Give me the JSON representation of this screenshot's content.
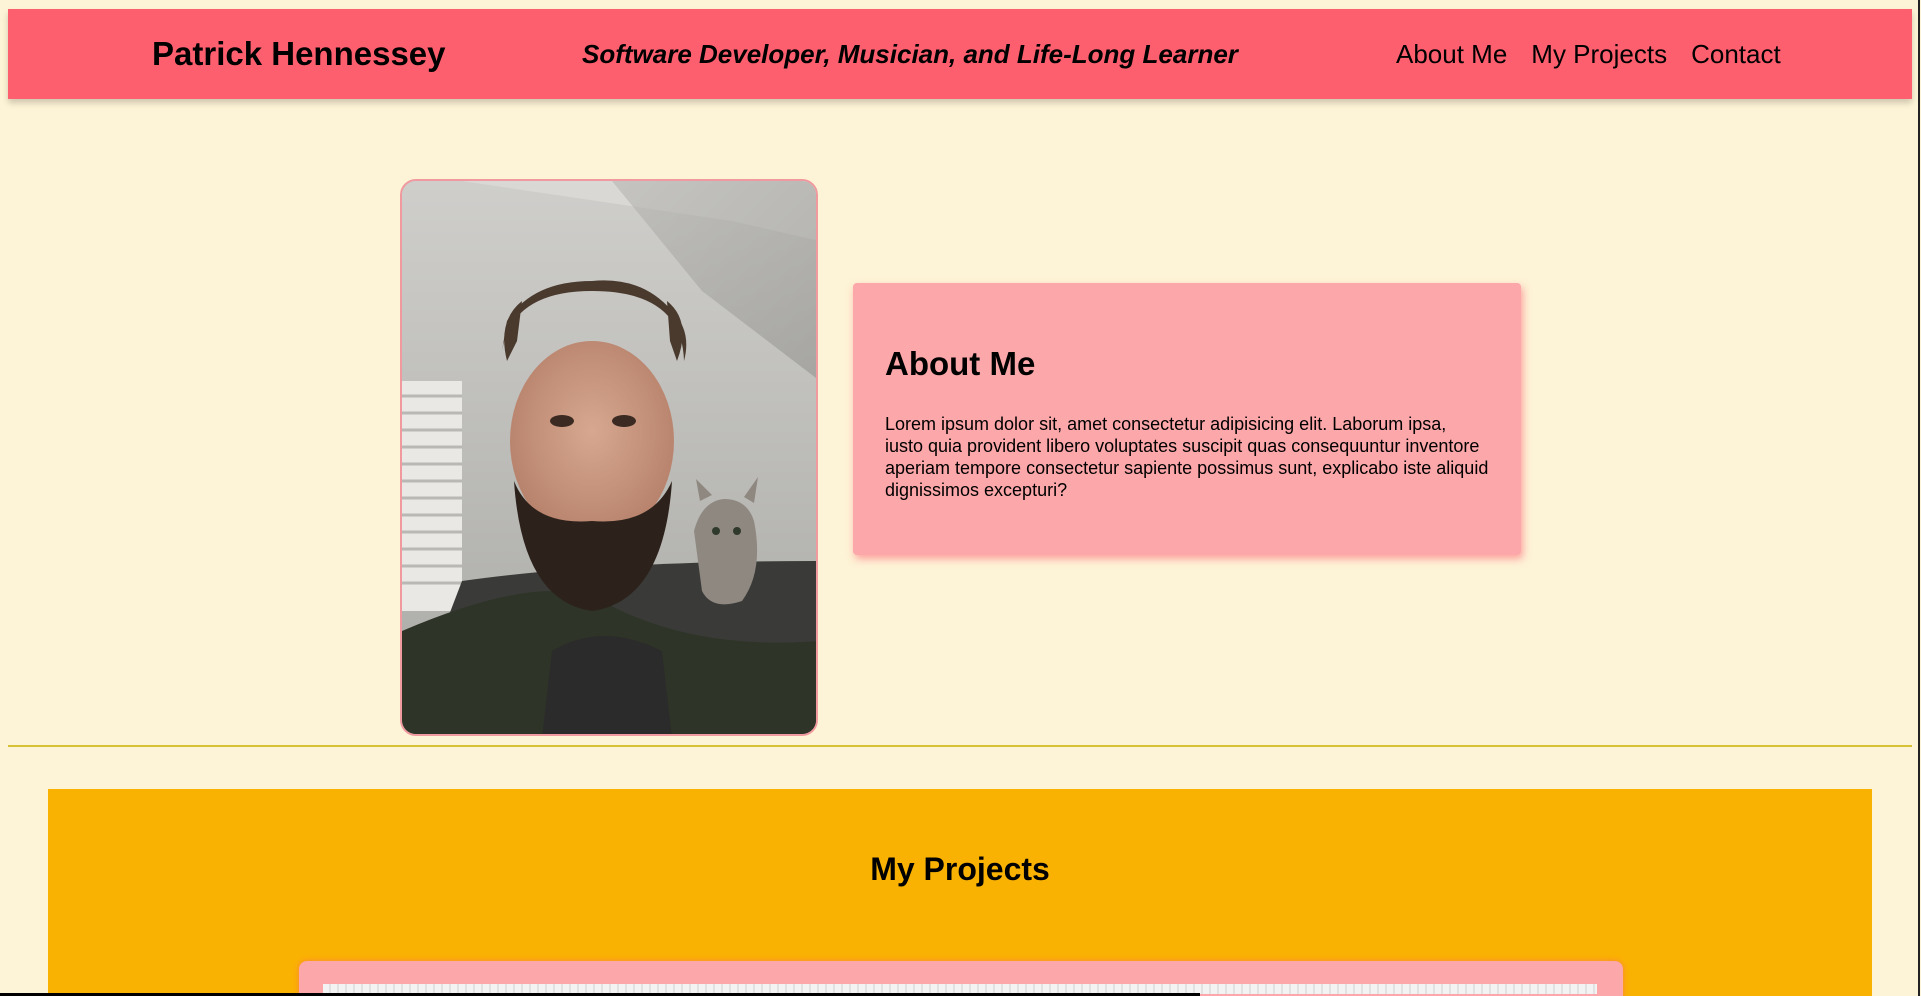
{
  "header": {
    "brand": "Patrick Hennessey",
    "tagline": "Software Developer, Musician, and Life-Long Learner",
    "nav": [
      {
        "label": "About Me"
      },
      {
        "label": "My Projects"
      },
      {
        "label": "Contact"
      }
    ]
  },
  "about": {
    "photo_alt": "Photo of Patrick Hennessey with a kitten on his shoulder",
    "title": "About Me",
    "body": "Lorem ipsum dolor sit, amet consectetur adipisicing elit. Laborum ipsa, iusto quia provident libero voluptates suscipit quas consequuntur inventore aperiam tempore consectetur sapiente possimus sunt, explicabo iste aliquid dignissimos excepturi?"
  },
  "projects": {
    "title": "My Projects"
  },
  "colors": {
    "background": "#fdf3d6",
    "header": "#fe5f6f",
    "card": "#fca7a9",
    "projects_band": "#fab202",
    "divider": "#d6c233"
  }
}
